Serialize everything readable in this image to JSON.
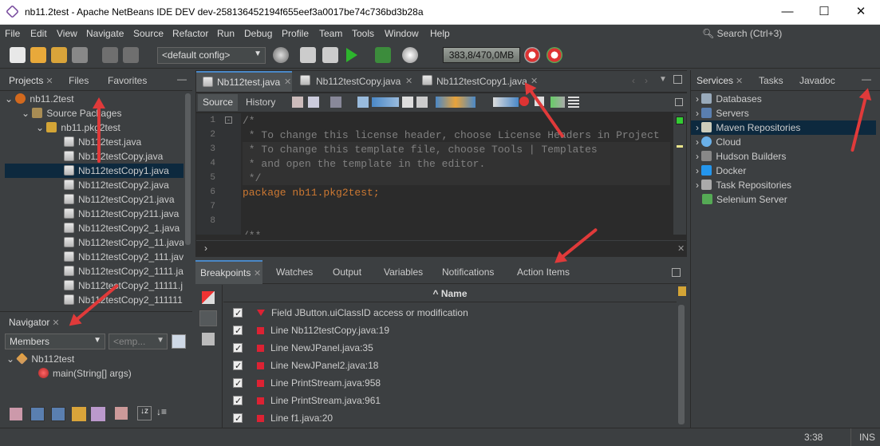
{
  "window": {
    "title": "nb11.2test - Apache NetBeans IDE DEV dev-258136452194f655eef3a0017be74c736bd3b28a",
    "minimize": "—",
    "maximize": "☐",
    "close": "✕"
  },
  "menu": [
    "File",
    "Edit",
    "View",
    "Navigate",
    "Source",
    "Refactor",
    "Run",
    "Debug",
    "Profile",
    "Team",
    "Tools",
    "Window",
    "Help"
  ],
  "search": {
    "placeholder": "Search (Ctrl+3)"
  },
  "toolbar": {
    "config": "<default config>",
    "memory": "383,8/470,0MB"
  },
  "projects": {
    "tabs": [
      "Projects",
      "Files",
      "Favorites"
    ],
    "root": "nb11.2test",
    "source_packages": "Source Packages",
    "package": "nb11.pkg2test",
    "files": [
      "Nb112test.java",
      "Nb112testCopy.java",
      "Nb112testCopy1.java",
      "Nb112testCopy2.java",
      "Nb112testCopy21.java",
      "Nb112testCopy211.java",
      "Nb112testCopy2_1.java",
      "Nb112testCopy2_11.java",
      "Nb112testCopy2_111.java",
      "Nb112testCopy2_1111.ja",
      "Nb112testCopy2_11111.j",
      "Nb112testCopy2_111111"
    ],
    "selected": 2
  },
  "navigator": {
    "tab": "Navigator",
    "members": "Members",
    "empty": "<emp...",
    "class": "Nb112test",
    "method": "main",
    "method_args": "(String[] args)"
  },
  "editor": {
    "tabs": [
      "Nb112test.java",
      "Nb112testCopy.java",
      "Nb112testCopy1.java"
    ],
    "active_tab": 0,
    "source": "Source",
    "history": "History",
    "line_numbers": [
      "1",
      "2",
      "3",
      "4",
      "5",
      "6",
      "7",
      "8"
    ],
    "lines": [
      "/*",
      " * To change this license header, choose License Headers in Project",
      " * To change this template file, choose Tools | Templates",
      " * and open the template in the editor.",
      " */",
      "package nb11.pkg2test;",
      "",
      "",
      "/**"
    ]
  },
  "bottom": {
    "tabs": [
      "Breakpoints",
      "Watches",
      "Output",
      "Variables",
      "Notifications",
      "Action Items"
    ],
    "column": "Name",
    "breakpoints": [
      {
        "label": "Field JButton.uiClassID access or modification",
        "kind": "field"
      },
      {
        "label": "Line Nb112testCopy.java:19",
        "kind": "line"
      },
      {
        "label": "Line NewJPanel.java:35",
        "kind": "line"
      },
      {
        "label": "Line NewJPanel2.java:18",
        "kind": "line"
      },
      {
        "label": "Line PrintStream.java:958",
        "kind": "line"
      },
      {
        "label": "Line PrintStream.java:961",
        "kind": "line"
      },
      {
        "label": "Line f1.java:20",
        "kind": "line"
      }
    ]
  },
  "services": {
    "tabs": [
      "Services",
      "Tasks",
      "Javadoc"
    ],
    "items": [
      "Databases",
      "Servers",
      "Maven Repositories",
      "Cloud",
      "Hudson Builders",
      "Docker",
      "Task Repositories",
      "Selenium Server"
    ],
    "selected": 2
  },
  "status": {
    "position": "3:38",
    "mode": "INS"
  }
}
